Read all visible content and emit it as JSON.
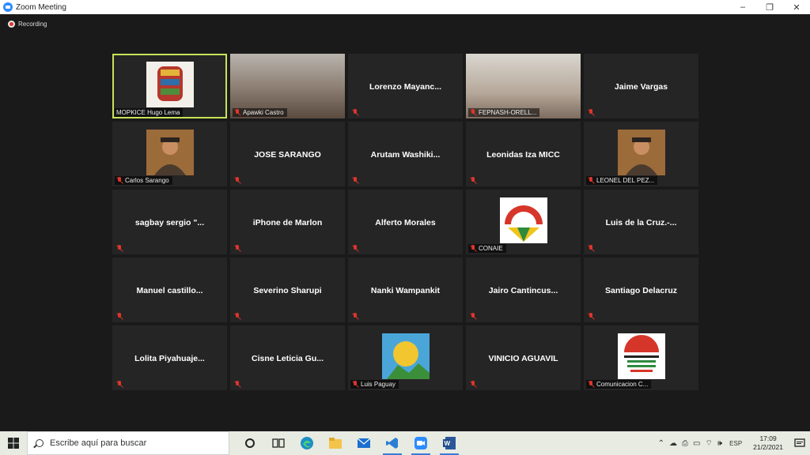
{
  "window": {
    "title": "Zoom Meeting",
    "minimize": "–",
    "restore": "❐",
    "close": "✕"
  },
  "meeting": {
    "recording_label": "Recording"
  },
  "tiles": [
    {
      "label": "MOPKICE Hugo Lema",
      "kind": "image",
      "icon": "fist-art-image",
      "active": true
    },
    {
      "label": "Apawki Castro",
      "kind": "video"
    },
    {
      "name": "Lorenzo  Mayanc..."
    },
    {
      "label": "FEPNASH-ORELL...",
      "kind": "video"
    },
    {
      "name": "Jaime Vargas"
    },
    {
      "label": "Carlos Sarango",
      "kind": "image",
      "icon": "portrait-photo"
    },
    {
      "name": "JOSE SARANGO"
    },
    {
      "name": "Arutam  Washiki..."
    },
    {
      "name": "Leonidas Iza MICC"
    },
    {
      "label": "LEONEL DEL PEZ...",
      "kind": "image",
      "icon": "portrait-photo"
    },
    {
      "name": "sagbay  sergio  \"..."
    },
    {
      "name": "iPhone de Marlon"
    },
    {
      "name": "Alferto Morales"
    },
    {
      "label": "CONAIE",
      "kind": "image",
      "icon": "conaie-logo"
    },
    {
      "name": "Luis de la Cruz.-..."
    },
    {
      "name": "Manuel  castillo..."
    },
    {
      "name": "Severino Sharupi"
    },
    {
      "name": "Nanki Wampankit"
    },
    {
      "name": "Jairo  Cantincus..."
    },
    {
      "name": "Santiago Delacruz"
    },
    {
      "name": "Lolita  Piyahuaje..."
    },
    {
      "name": "Cisne  Leticia  Gu..."
    },
    {
      "label": "Luis Paguay",
      "kind": "image",
      "icon": "sun-art-image"
    },
    {
      "name": "VINICIO AGUAVIL"
    },
    {
      "label": "Comunicacion C...",
      "kind": "image",
      "icon": "unity-territory-logo"
    }
  ],
  "taskbar": {
    "search_placeholder": "Escribe aquí para buscar",
    "language": "ESP",
    "time": "17:09",
    "date": "21/2/2021"
  },
  "colors": {
    "muted": "#e0352b",
    "active_speaker": "#c8e25a",
    "zoom_blue": "#2d8cff"
  }
}
